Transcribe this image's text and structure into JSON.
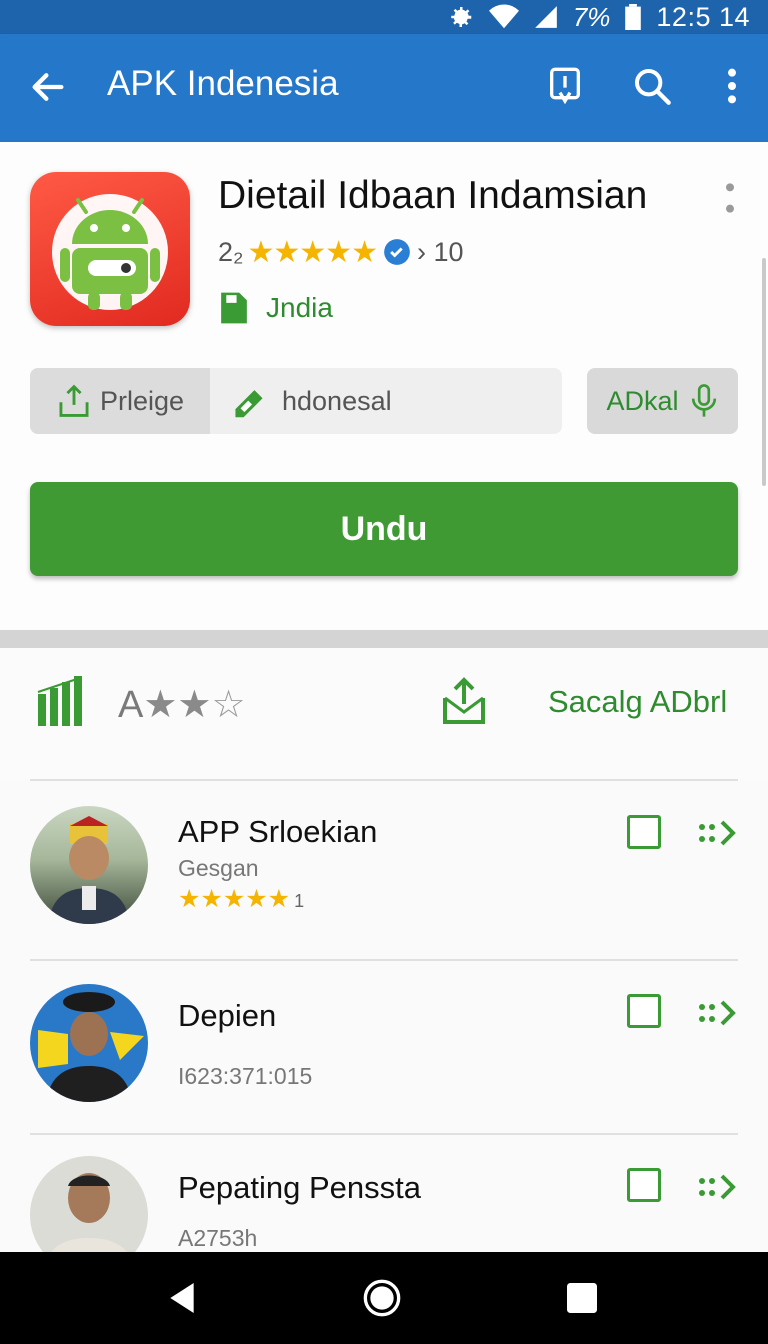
{
  "status_bar": {
    "battery": "7%",
    "time": "12:5 14"
  },
  "app_bar": {
    "title": "APK Indenesia"
  },
  "app": {
    "title": "Dietail Idbaan Indamsian",
    "rating_prefix": "2₂",
    "stars": "★★★★★",
    "downloads": "› 10",
    "developer": "Jndia"
  },
  "actions": {
    "share_label": "Prleige",
    "region_label": "hdonesal",
    "adkal_label": "ADkal",
    "download_label": "Undu"
  },
  "filter": {
    "rating_letter": "A",
    "rating_stars_filled": "★★",
    "rating_stars_empty": "☆",
    "sort_label": "Sacalg ADbrl"
  },
  "list": [
    {
      "title": "APP Srloekian",
      "subtitle": "Gesgan",
      "stars": "★★★★★",
      "count": "1"
    },
    {
      "title": "Depien",
      "subtitle": "I623:371:015"
    },
    {
      "title": "Pepating Penssta",
      "subtitle": "A2753h"
    }
  ],
  "colors": {
    "status_bar": "#1e64ad",
    "app_bar": "#2577c9",
    "primary_green": "#3f9a34",
    "star_yellow": "#f5b400"
  },
  "icons": [
    "back-arrow-icon",
    "download-info-icon",
    "search-icon",
    "more-vert-icon",
    "settings-icon",
    "wifi-icon",
    "signal-icon",
    "battery-icon",
    "share-icon",
    "tag-icon",
    "mic-icon",
    "bar-chart-icon",
    "inbox-share-icon",
    "forward-arrow-icon"
  ]
}
